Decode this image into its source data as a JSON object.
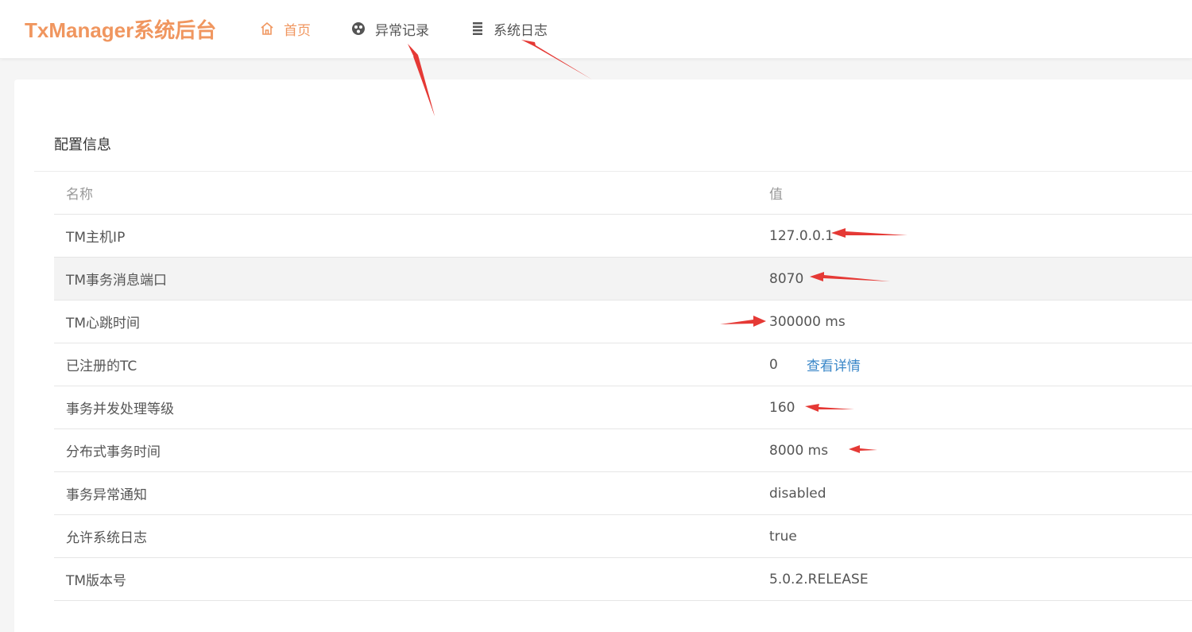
{
  "app": {
    "title": "TxManager系统后台"
  },
  "nav": {
    "home": {
      "label": "首页",
      "icon": "home-icon"
    },
    "exceptions": {
      "label": "异常记录",
      "icon": "exception-icon"
    },
    "logs": {
      "label": "系统日志",
      "icon": "list-icon"
    }
  },
  "section": {
    "title": "配置信息"
  },
  "table": {
    "headers": {
      "name": "名称",
      "value": "值"
    },
    "rows": [
      {
        "name": "TM主机IP",
        "value": "127.0.0.1"
      },
      {
        "name": "TM事务消息端口",
        "value": "8070"
      },
      {
        "name": "TM心跳时间",
        "value": "300000 ms"
      },
      {
        "name": "已注册的TC",
        "value": "0",
        "link": "查看详情"
      },
      {
        "name": "事务并发处理等级",
        "value": "160"
      },
      {
        "name": "分布式事务时间",
        "value": "8000 ms"
      },
      {
        "name": "事务异常通知",
        "value": "disabled"
      },
      {
        "name": "允许系统日志",
        "value": "true"
      },
      {
        "name": "TM版本号",
        "value": "5.0.2.RELEASE"
      }
    ]
  },
  "colors": {
    "accent": "#f0965f",
    "link": "#3a87c8",
    "annotation_arrow": "#e53935"
  }
}
